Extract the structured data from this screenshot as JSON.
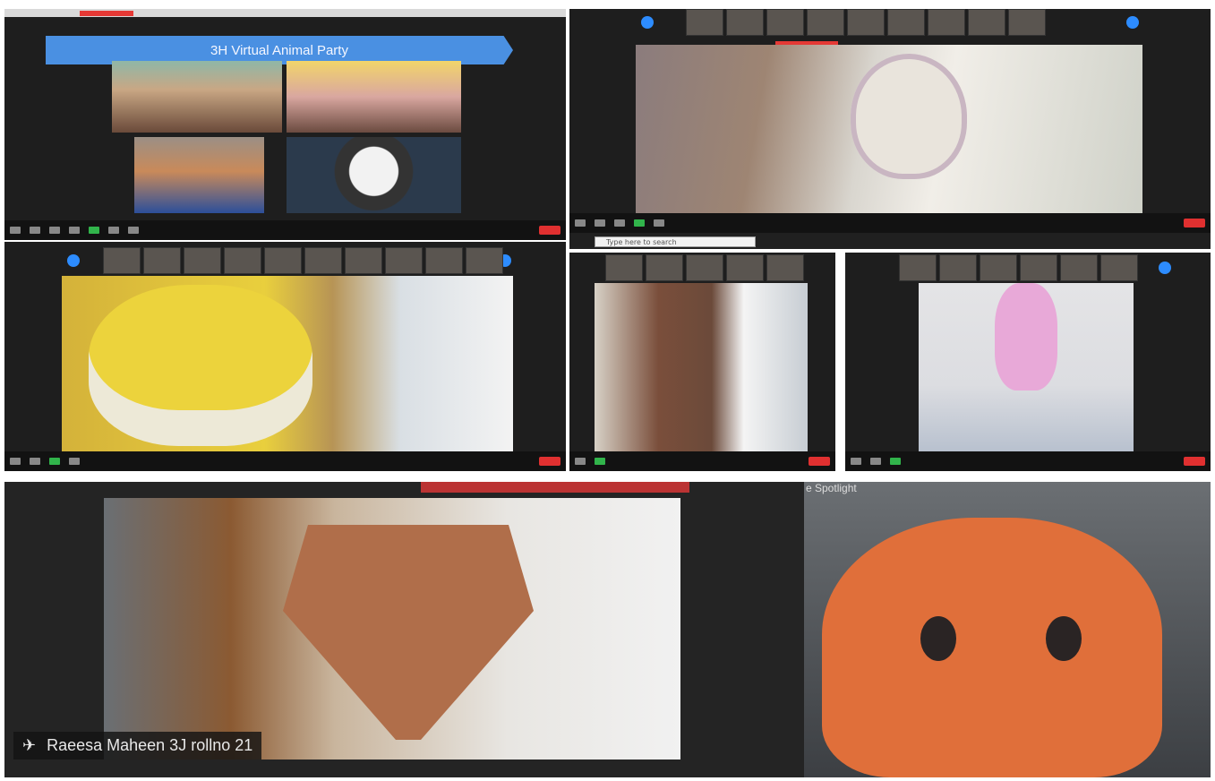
{
  "top_left": {
    "banner_text": "3H Virtual Animal Party"
  },
  "search": {
    "placeholder": "Type here to search"
  },
  "bottom_left": {
    "participant_name": "Raeesa Maheen 3J rollno 21"
  },
  "bottom_right": {
    "spotlight_label": "e Spotlight"
  },
  "icons": {
    "participant": "person-icon",
    "record": "recording-indicator",
    "nav": "nav-arrow-icon"
  },
  "colors": {
    "zoom_bg": "#1e1e1e",
    "banner": "#4a90e2",
    "end_button": "#e03030",
    "mute_on": "#31b44b"
  }
}
